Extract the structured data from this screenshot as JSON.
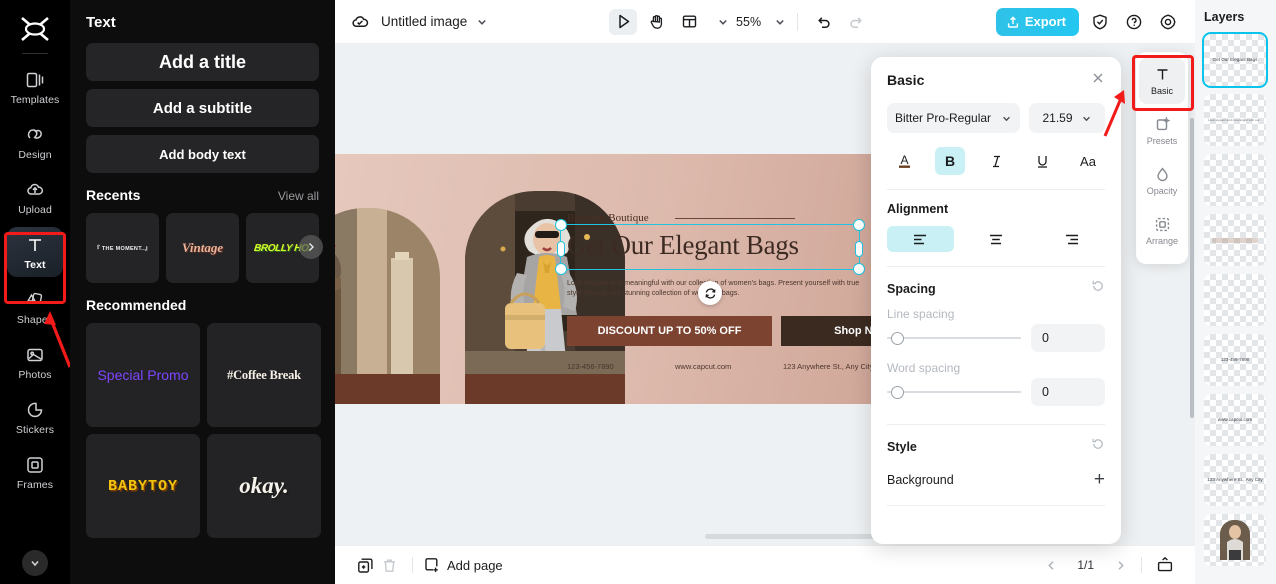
{
  "rail": {
    "logo_icon": "capcut-logo-icon",
    "items": [
      {
        "label": "Templates",
        "icon": "templates-icon"
      },
      {
        "label": "Design",
        "icon": "design-icon"
      },
      {
        "label": "Upload",
        "icon": "upload-cloud-icon"
      },
      {
        "label": "Text",
        "icon": "text-t-icon",
        "active": true
      },
      {
        "label": "Shapes",
        "icon": "shapes-icon"
      },
      {
        "label": "Photos",
        "icon": "photos-image-icon"
      },
      {
        "label": "Stickers",
        "icon": "stickers-icon"
      },
      {
        "label": "Frames",
        "icon": "frames-icon"
      }
    ],
    "more_icon": "chevron-down-icon"
  },
  "text_panel": {
    "title": "Text",
    "add_buttons": [
      {
        "label": "Add a title"
      },
      {
        "label": "Add a subtitle"
      },
      {
        "label": "Add body text"
      }
    ],
    "recents": {
      "title": "Recents",
      "view_all": "View all",
      "items": [
        {
          "label": "『 THE MOMENT..』"
        },
        {
          "label": "Vintage"
        },
        {
          "label": "BROLLY HO."
        }
      ],
      "next_icon": "chevron-right-icon"
    },
    "recommended": {
      "title": "Recommended",
      "items": [
        {
          "label": "Special Promo"
        },
        {
          "label": "#Coffee Break"
        },
        {
          "label": "BABYTOY"
        },
        {
          "label": "okay."
        }
      ]
    }
  },
  "topbar": {
    "cloud_icon": "cloud-saved-icon",
    "doc_name": "Untitled image",
    "name_caret_icon": "chevron-down-icon",
    "select_tool_icon": "cursor-play-icon",
    "hand_tool_icon": "hand-icon",
    "layout_tool_icon": "layout-grid-icon",
    "layout_caret_icon": "chevron-down-icon",
    "zoom": "55%",
    "zoom_caret_icon": "chevron-down-icon",
    "undo_icon": "undo-icon",
    "redo_icon": "redo-icon",
    "export_label": "Export",
    "export_icon": "export-upload-icon",
    "shield_icon": "shield-check-icon",
    "help_icon": "question-circle-icon",
    "settings_icon": "gear-icon"
  },
  "canvas": {
    "corner_icon": "image-stack-icon",
    "float_toolbar": {
      "duplicate_icon": "duplicate-icon",
      "more_icon": "more-horizontal-icon"
    },
    "rotate_icon": "rotate-icon",
    "design": {
      "brand": "Blossom Boutique",
      "headline": "Get Our Elegant Bags",
      "body": "Look elegant and meaningful with our collection of women's bags. Present yourself with true style through our stunning collection of women's bags.",
      "cta_primary": "DISCOUNT UP TO 50% OFF",
      "cta_secondary": "Shop Now",
      "footer": [
        "123-456-7890",
        "www.capcut.com",
        "123 Anywhere St., Any City"
      ]
    }
  },
  "bottombar": {
    "duplicate_page_icon": "duplicate-page-icon",
    "delete_icon": "trash-icon",
    "add_page_label": "Add page",
    "add_page_icon": "add-page-icon",
    "prev_icon": "chevron-left-icon",
    "page_indicator": "1/1",
    "next_icon": "chevron-right-icon",
    "present_icon": "present-icon"
  },
  "properties": {
    "title": "Basic",
    "close_icon": "close-icon",
    "font_family": "Bitter Pro-Regular",
    "font_family_caret_icon": "chevron-down-icon",
    "font_size": "21.59",
    "font_size_caret_icon": "chevron-down-icon",
    "format_buttons": [
      {
        "name": "text-color-button",
        "glyph": "A",
        "active": false
      },
      {
        "name": "bold-button",
        "glyph": "B",
        "active": true
      },
      {
        "name": "italic-button",
        "glyph": "I",
        "active": false
      },
      {
        "name": "underline-button",
        "glyph": "U",
        "active": false
      },
      {
        "name": "case-button",
        "glyph": "Aa",
        "active": false
      }
    ],
    "alignment_label": "Alignment",
    "alignment_options": [
      {
        "name": "align-left-button",
        "active": true
      },
      {
        "name": "align-center-button",
        "active": false
      },
      {
        "name": "align-right-button",
        "active": false
      }
    ],
    "spacing_label": "Spacing",
    "spacing_reset_icon": "reset-icon",
    "line_spacing_label": "Line spacing",
    "line_spacing_value": "0",
    "word_spacing_label": "Word spacing",
    "word_spacing_value": "0",
    "style_label": "Style",
    "style_reset_icon": "reset-icon",
    "background_label": "Background",
    "background_add_icon": "plus-icon"
  },
  "toolstrip": {
    "items": [
      {
        "label": "Basic",
        "icon": "text-t-icon",
        "active": true
      },
      {
        "label": "Presets",
        "icon": "presets-icon",
        "active": false
      },
      {
        "label": "Opacity",
        "icon": "opacity-drop-icon",
        "active": false
      },
      {
        "label": "Arrange",
        "icon": "arrange-icon",
        "active": false
      }
    ]
  },
  "layers": {
    "title": "Layers",
    "items": [
      {
        "preview": "Get Our Elegant Bags",
        "type": "text",
        "selected": true
      },
      {
        "preview": "Look elegant and meaningful with our...",
        "type": "text-small",
        "selected": false
      },
      {
        "preview": "",
        "type": "blank",
        "selected": false
      },
      {
        "preview": "",
        "type": "blob",
        "selected": false
      },
      {
        "preview": "",
        "type": "blank",
        "selected": false
      },
      {
        "preview": "123-456-7890",
        "type": "text",
        "selected": false
      },
      {
        "preview": "www.capcut.com",
        "type": "text",
        "selected": false
      },
      {
        "preview": "123 Anywhere St., Any City",
        "type": "text",
        "selected": false
      },
      {
        "preview": "",
        "type": "photo",
        "selected": false
      }
    ]
  },
  "annotations": {
    "highlight_color": "#f31a1a",
    "arrow_to_text_tool": true,
    "arrow_to_basic_tool": true
  },
  "colors": {
    "accent": "#23c7f0",
    "selection": "#21c4e0",
    "active_toggle": "#c8f0f5",
    "rail_bg": "#000000",
    "panel_bg": "#0d0d0d",
    "canvas_bg": "#eef1f3"
  }
}
